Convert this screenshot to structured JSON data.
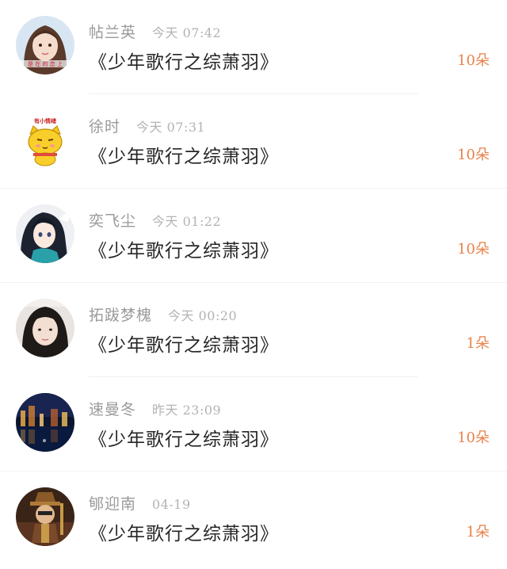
{
  "gift_list": [
    {
      "name": "帖兰英",
      "time": "今天 07:42",
      "title": "《少年歌行之综萧羽》",
      "amount": "10朵",
      "avatar_icon": "girl-photo-avatar"
    },
    {
      "name": "徐时",
      "time": "今天 07:31",
      "title": "《少年歌行之综萧羽》",
      "amount": "10朵",
      "avatar_icon": "cartoon-cat-avatar"
    },
    {
      "name": "奕飞尘",
      "time": "今天 01:22",
      "title": "《少年歌行之综萧羽》",
      "amount": "10朵",
      "avatar_icon": "anime-girl-avatar"
    },
    {
      "name": "拓跋梦槐",
      "time": "今天 00:20",
      "title": "《少年歌行之综萧羽》",
      "amount": "1朵",
      "avatar_icon": "selfie-avatar"
    },
    {
      "name": "速曼冬",
      "time": "昨天 23:09",
      "title": "《少年歌行之综萧羽》",
      "amount": "10朵",
      "avatar_icon": "night-city-avatar"
    },
    {
      "name": "郇迎南",
      "time": "04-19",
      "title": "《少年歌行之综萧羽》",
      "amount": "1朵",
      "avatar_icon": "game-character-avatar"
    }
  ],
  "colors": {
    "name": "#9a9a9a",
    "time": "#b3b3b3",
    "title": "#262626",
    "amount": "#e8824b",
    "divider": "#f0f0f0"
  }
}
